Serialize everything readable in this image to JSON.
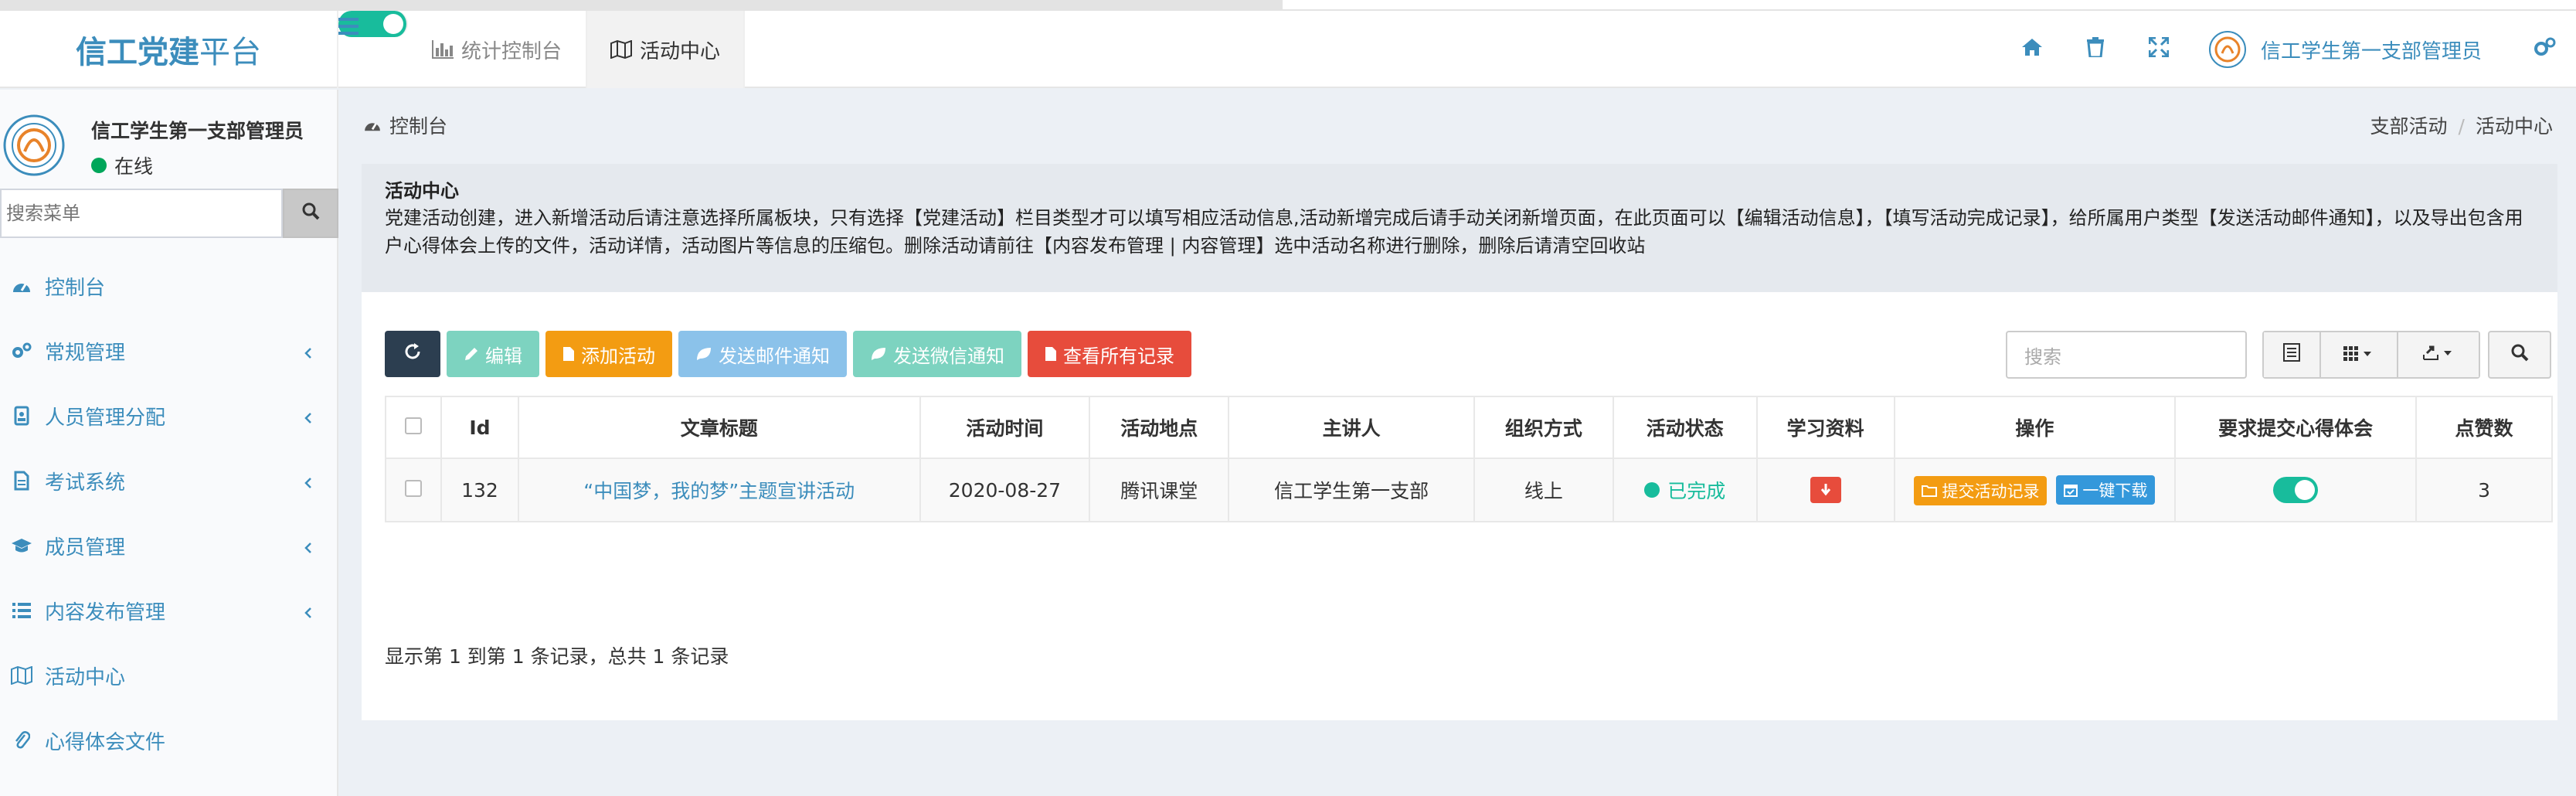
{
  "app": {
    "logo_main": "信工党建",
    "logo_sub": "平台"
  },
  "header": {
    "tabs": [
      {
        "label": "统计控制台"
      },
      {
        "label": "活动中心"
      }
    ],
    "user_name": "信工学生第一支部管理员"
  },
  "sidebar": {
    "user_name": "信工学生第一支部管理员",
    "status": "在线",
    "search_placeholder": "搜索菜单",
    "items": [
      {
        "label": "控制台",
        "icon": "dashboard-icon"
      },
      {
        "label": "常规管理",
        "icon": "cogs-icon"
      },
      {
        "label": "人员管理分配",
        "icon": "id-badge-icon"
      },
      {
        "label": "考试系统",
        "icon": "file-icon"
      },
      {
        "label": "成员管理",
        "icon": "graduation-cap-icon"
      },
      {
        "label": "内容发布管理",
        "icon": "list-icon"
      },
      {
        "label": "活动中心",
        "icon": "map-icon"
      },
      {
        "label": "心得体会文件",
        "icon": "paperclip-icon"
      }
    ]
  },
  "breadcrumb": {
    "left": "控制台",
    "right": [
      "支部活动",
      "活动中心"
    ]
  },
  "callout": {
    "title": "活动中心",
    "body": "党建活动创建，进入新增活动后请注意选择所属板块，只有选择【党建活动】栏目类型才可以填写相应活动信息,活动新增完成后请手动关闭新增页面，在此页面可以【编辑活动信息】，【填写活动完成记录】，给所属用户类型【发送活动邮件通知】，以及导出包含用户心得体会上传的文件，活动详情，活动图片等信息的压缩包。删除活动请前往【内容发布管理 | 内容管理】选中活动名称进行删除，删除后请清空回收站"
  },
  "toolbar": {
    "edit": "编辑",
    "add": "添加活动",
    "email": "发送邮件通知",
    "wechat": "发送微信通知",
    "records": "查看所有记录",
    "search_placeholder": "搜索"
  },
  "table": {
    "headers": [
      "Id",
      "文章标题",
      "活动时间",
      "活动地点",
      "主讲人",
      "组织方式",
      "活动状态",
      "学习资料",
      "操作",
      "要求提交心得体会",
      "点赞数"
    ],
    "rows": [
      {
        "id": "132",
        "title": "“中国梦，我的梦”主题宣讲活动",
        "date": "2020-08-27",
        "place": "腾讯课堂",
        "speaker": "信工学生第一支部",
        "mode": "线上",
        "status": "已完成",
        "op_submit": "提交活动记录",
        "op_download": "一键下载",
        "require_reflection": true,
        "likes": "3"
      }
    ],
    "footer": "显示第 1 到第 1 条记录，总共 1 条记录"
  },
  "colors": {
    "accent": "#3c8dbc",
    "success": "#18bc9c",
    "warning": "#f39c12",
    "danger": "#e74c3c"
  }
}
